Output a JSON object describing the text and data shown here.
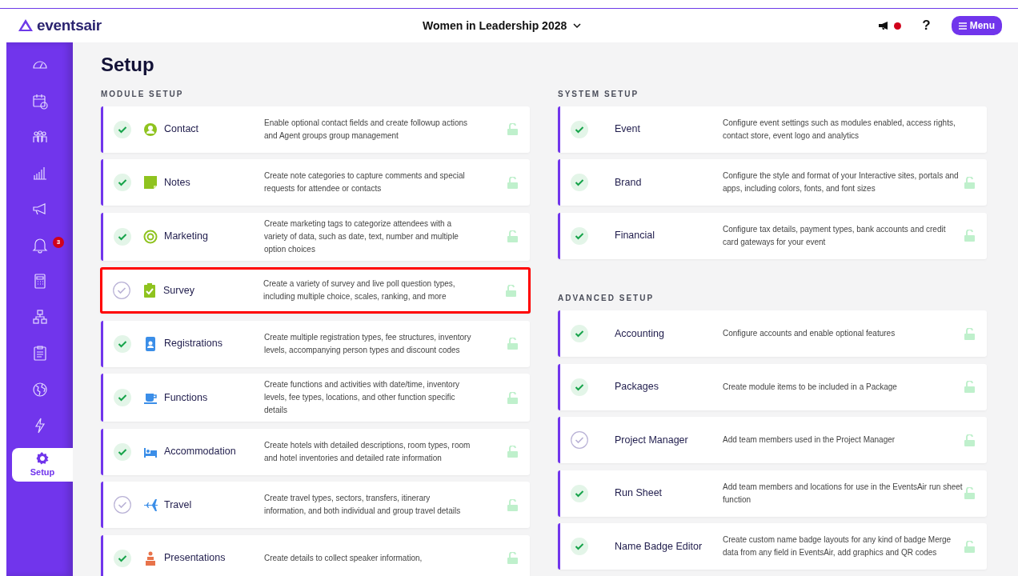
{
  "header": {
    "logo": "eventsair",
    "event_title": "Women in Leadership 2028",
    "notification_dot": true,
    "help": "?",
    "menu_button": "Menu"
  },
  "sidebar": {
    "items": [
      {
        "selected": false
      },
      {
        "selected": false
      },
      {
        "selected": false
      },
      {
        "selected": false
      },
      {
        "selected": false
      },
      {
        "selected": false,
        "badge": "3"
      },
      {
        "selected": false
      },
      {
        "selected": false
      },
      {
        "selected": false
      },
      {
        "selected": false
      },
      {
        "selected": false
      },
      {
        "selected": true,
        "label": "Setup"
      }
    ]
  },
  "page_title": "Setup",
  "module_setup": {
    "heading": "MODULE SETUP",
    "items": [
      {
        "name": "Contact",
        "description": "Enable optional contact fields and create followup actions and Agent groups group management",
        "enabled": true,
        "lock": true,
        "highlighted": false
      },
      {
        "name": "Notes",
        "description": "Create note categories to capture comments and special requests for attendee or contacts",
        "enabled": true,
        "lock": true,
        "highlighted": false
      },
      {
        "name": "Marketing",
        "description": "Create marketing tags to categorize attendees with a variety of data, such as date, text, number and multiple option choices",
        "enabled": true,
        "lock": true,
        "highlighted": false
      },
      {
        "name": "Survey",
        "description": "Create a variety of survey and live poll question types, including multiple choice, scales, ranking, and more",
        "enabled": false,
        "lock": true,
        "highlighted": true
      },
      {
        "name": "Registrations",
        "description": "Create multiple registration types, fee structures, inventory levels, accompanying person types and discount codes",
        "enabled": true,
        "lock": true,
        "highlighted": false
      },
      {
        "name": "Functions",
        "description": "Create functions and activities with date/time, inventory levels, fee types, locations, and other function specific details",
        "enabled": true,
        "lock": true,
        "highlighted": false
      },
      {
        "name": "Accommodation",
        "description": "Create hotels with detailed descriptions, room types, room and hotel inventories and detailed rate information",
        "enabled": true,
        "lock": true,
        "highlighted": false
      },
      {
        "name": "Travel",
        "description": "Create travel types, sectors, transfers, itinerary information, and both individual and group travel details",
        "enabled": false,
        "lock": true,
        "highlighted": false
      },
      {
        "name": "Presentations",
        "description": "Create details to collect speaker information,",
        "enabled": true,
        "lock": true,
        "highlighted": false
      }
    ]
  },
  "system_setup": {
    "heading": "SYSTEM SETUP",
    "items": [
      {
        "name": "Event",
        "description": "Configure event settings such as modules enabled, access rights, contact store, event logo and analytics",
        "enabled": true,
        "lock": false
      },
      {
        "name": "Brand",
        "description": "Configure the style and format of your Interactive sites, portals and apps, including colors, fonts, and font sizes",
        "enabled": true,
        "lock": true
      },
      {
        "name": "Financial",
        "description": "Configure tax details, payment types, bank accounts and credit card gateways for your event",
        "enabled": true,
        "lock": true
      }
    ]
  },
  "advanced_setup": {
    "heading": "ADVANCED SETUP",
    "items": [
      {
        "name": "Accounting",
        "description": "Configure accounts and enable optional features",
        "enabled": true,
        "lock": true
      },
      {
        "name": "Packages",
        "description": "Create module items to be included in a Package",
        "enabled": true,
        "lock": true
      },
      {
        "name": "Project Manager",
        "description": "Add team members used in the Project Manager",
        "enabled": false,
        "lock": true
      },
      {
        "name": "Run Sheet",
        "description": "Add team members and locations for use in the EventsAir run sheet function",
        "enabled": true,
        "lock": true
      },
      {
        "name": "Name Badge Editor",
        "description": "Create custom name badge layouts for any kind of badge Merge data from any field in EventsAir, add graphics and QR codes",
        "enabled": true,
        "lock": true
      }
    ]
  }
}
